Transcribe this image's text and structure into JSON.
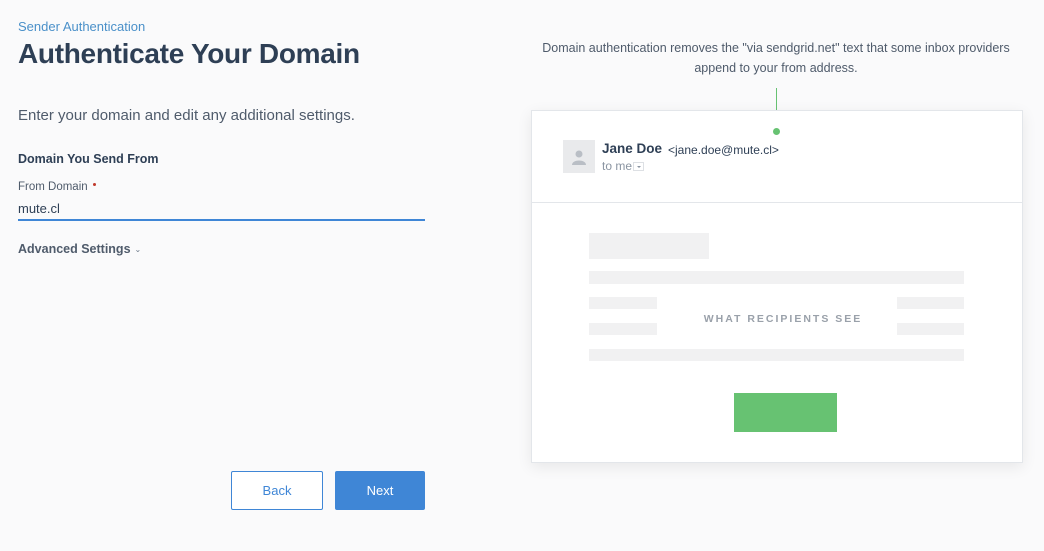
{
  "breadcrumb": "Sender Authentication",
  "title": "Authenticate Your Domain",
  "intro": "Enter your domain and edit any additional settings.",
  "section": {
    "heading": "Domain You Send From",
    "from_domain_label": "From Domain",
    "from_domain_value": "mute.cl"
  },
  "advanced_settings_label": "Advanced Settings",
  "buttons": {
    "back": "Back",
    "next": "Next"
  },
  "preview": {
    "description": "Domain authentication removes the \"via sendgrid.net\" text that some inbox providers append to your from address.",
    "sender_name": "Jane Doe",
    "sender_email": "<jane.doe@mute.cl>",
    "to_me": "to me",
    "recipients_label": "WHAT RECIPIENTS SEE"
  },
  "colors": {
    "accent": "#3f86d6",
    "connector": "#67c272",
    "cta_placeholder": "#67c272",
    "required": "#c0392b"
  }
}
